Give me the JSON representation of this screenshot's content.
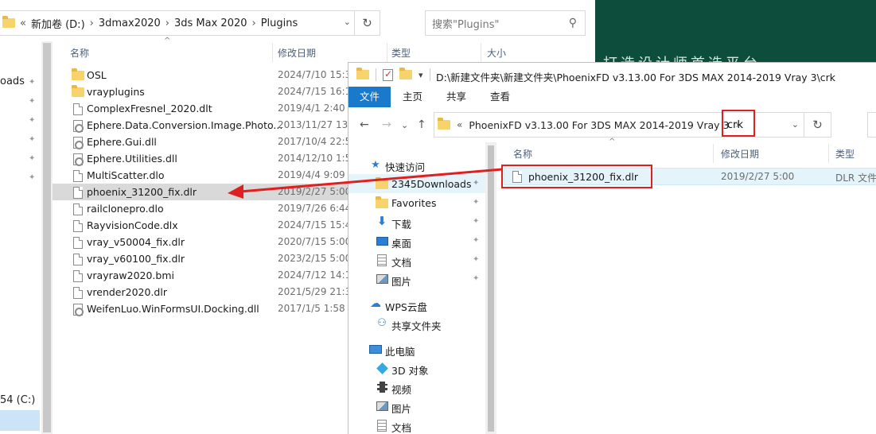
{
  "back_window": {
    "address": {
      "prefix": "«",
      "crumbs": [
        "新加卷 (D:)",
        "3dmax2020",
        "3ds Max 2020",
        "Plugins"
      ],
      "separator": "›",
      "dropdown": "⌄",
      "refresh": "↻"
    },
    "search": {
      "placeholder": "搜索\"Plugins\"",
      "icon": "search-icon"
    },
    "nav": {
      "item_top": "oads",
      "item_bottom": "54 (C:)",
      "pin": "📌"
    },
    "columns": {
      "name": "名称",
      "date": "修改日期",
      "type": "类型",
      "size": "大小",
      "sort_arrow": "^"
    },
    "files": [
      {
        "name": "OSL",
        "date": "2024/7/10 15:3",
        "icon": "folder-icon"
      },
      {
        "name": "vrayplugins",
        "date": "2024/7/15 16:1",
        "icon": "folder-icon"
      },
      {
        "name": "ComplexFresnel_2020.dlt",
        "date": "2019/4/1 2:40",
        "icon": "file-icon"
      },
      {
        "name": "Ephere.Data.Conversion.Image.Photo...",
        "date": "2013/11/27 13:",
        "icon": "gear-file-icon"
      },
      {
        "name": "Ephere.Gui.dll",
        "date": "2017/10/4 22:5",
        "icon": "gear-file-icon"
      },
      {
        "name": "Ephere.Utilities.dll",
        "date": "2014/12/10 1:5",
        "icon": "gear-file-icon"
      },
      {
        "name": "MultiScatter.dlo",
        "date": "2019/4/4 9:09",
        "icon": "file-icon"
      },
      {
        "name": "phoenix_31200_fix.dlr",
        "date": "2019/2/27 5:00",
        "icon": "file-icon"
      },
      {
        "name": "railclonepro.dlo",
        "date": "2019/7/26 6:44",
        "icon": "file-icon"
      },
      {
        "name": "RayvisionCode.dlx",
        "date": "2024/7/15 15:4",
        "icon": "file-icon"
      },
      {
        "name": "vray_v50004_fix.dlr",
        "date": "2020/7/15 5:00",
        "icon": "file-icon"
      },
      {
        "name": "vray_v60100_fix.dlr",
        "date": "2023/2/15 5:00",
        "icon": "file-icon"
      },
      {
        "name": "vrayraw2020.bmi",
        "date": "2024/7/12 14:1",
        "icon": "file-icon"
      },
      {
        "name": "vrender2020.dlr",
        "date": "2021/5/29 21:3",
        "icon": "file-icon"
      },
      {
        "name": "WeifenLuo.WinFormsUI.Docking.dll",
        "date": "2017/1/5 1:58",
        "icon": "gear-file-icon"
      }
    ],
    "selected_index": 7
  },
  "background": {
    "slogan": "打造设计师首选平台",
    "color": "#0d4d3b"
  },
  "front_window": {
    "title_path": "D:\\新建文件夹\\新建文件夹\\PhoenixFD v3.13.00 For 3DS MAX 2014-2019 Vray 3\\crk",
    "qa_dropdown": "▾",
    "ribbon": {
      "file": "文件",
      "home": "主页",
      "share": "共享",
      "view": "查看"
    },
    "nav_buttons": {
      "back": "←",
      "forward": "→",
      "recent": "⌄",
      "up": "↑"
    },
    "address": {
      "prefix": "«",
      "crumb": "PhoenixFD v3.13.00 For 3DS MAX 2014-2019 Vray 3",
      "separator": "›",
      "current": "crk",
      "dropdown": "⌄",
      "refresh": "↻"
    },
    "nav": {
      "quick_access": "快速访问",
      "items": [
        {
          "label": "2345Downloads",
          "icon": "folder-icon",
          "pinned": true
        },
        {
          "label": "Favorites",
          "icon": "folder-icon",
          "pinned": true
        },
        {
          "label": "下载",
          "icon": "download-icon",
          "pinned": true
        },
        {
          "label": "桌面",
          "icon": "desktop-icon",
          "pinned": true
        },
        {
          "label": "文档",
          "icon": "document-icon",
          "pinned": true
        },
        {
          "label": "图片",
          "icon": "picture-icon",
          "pinned": true
        }
      ],
      "wps_cloud": "WPS云盘",
      "shared_folder": "共享文件夹",
      "this_pc": "此电脑",
      "pc_items": [
        {
          "label": "3D 对象",
          "icon": "3d-objects-icon"
        },
        {
          "label": "视频",
          "icon": "video-icon"
        },
        {
          "label": "图片",
          "icon": "picture-icon"
        },
        {
          "label": "文档",
          "icon": "document-icon"
        }
      ],
      "pin": "📌"
    },
    "columns": {
      "name": "名称",
      "date": "修改日期",
      "type": "类型",
      "sort_arrow": "^"
    },
    "file": {
      "name": "phoenix_31200_fix.dlr",
      "date": "2019/2/27 5:00",
      "type": "DLR 文件"
    }
  },
  "colors": {
    "highlight_red": "#e02020",
    "ribbon_blue": "#1979ca",
    "selection": "#cce4f7"
  }
}
